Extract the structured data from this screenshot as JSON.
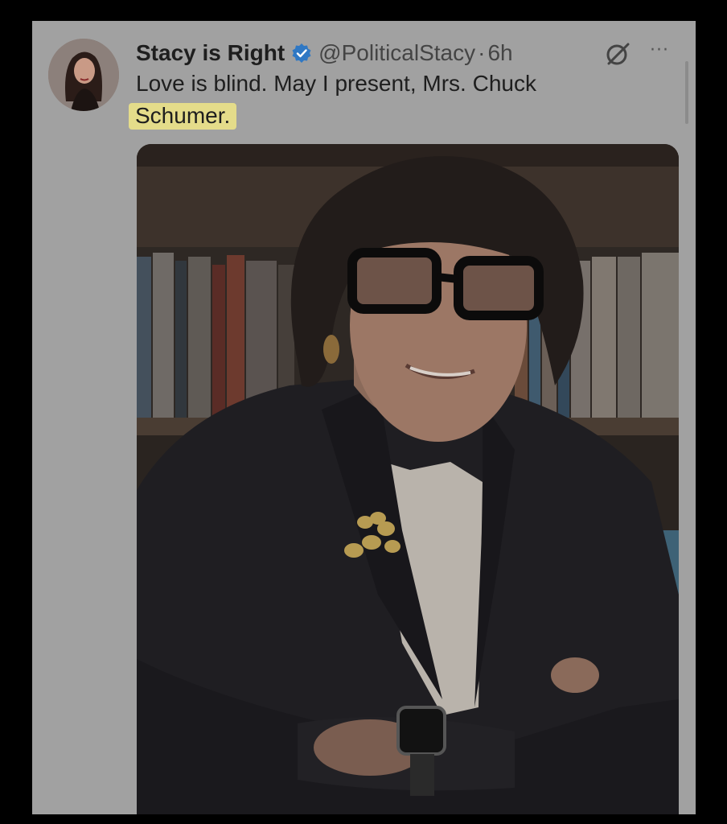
{
  "tweet": {
    "display_name": "Stacy is Right",
    "handle": "@PoliticalStacy",
    "separator": "·",
    "time": "6h",
    "text_part1": "Love is blind. May I present, Mrs. Chuck",
    "text_highlighted": "Schumer.",
    "more_label": "···"
  },
  "icons": {
    "verified": "verified-badge-icon",
    "grok": "grok-icon",
    "more": "more-options-icon"
  },
  "colors": {
    "frame_bg": "#a1a1a1",
    "outer_bg": "#000000",
    "verified_blue": "#2f78c4",
    "highlight": "#e4dc8a",
    "text": "#1e1e1e"
  }
}
